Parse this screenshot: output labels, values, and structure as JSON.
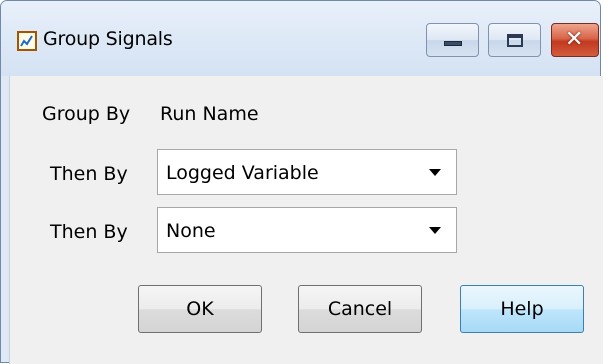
{
  "window": {
    "title": "Group Signals",
    "icon": "chart-line-icon"
  },
  "title_buttons": {
    "minimize": "minimize-icon",
    "maximize": "maximize-icon",
    "close": "close-icon",
    "close_glyph": "✕"
  },
  "form": {
    "group_by_label": "Group By",
    "group_by_value": "Run Name",
    "then_by_1": {
      "label": "Then By",
      "selected": "Logged Variable"
    },
    "then_by_2": {
      "label": "Then By",
      "selected": "None"
    }
  },
  "buttons": {
    "ok": "OK",
    "cancel": "Cancel",
    "help": "Help"
  },
  "colors": {
    "close_button": "#c3391f",
    "help_button": "#a7d9f5",
    "titlebar": "#d4e2f3"
  }
}
